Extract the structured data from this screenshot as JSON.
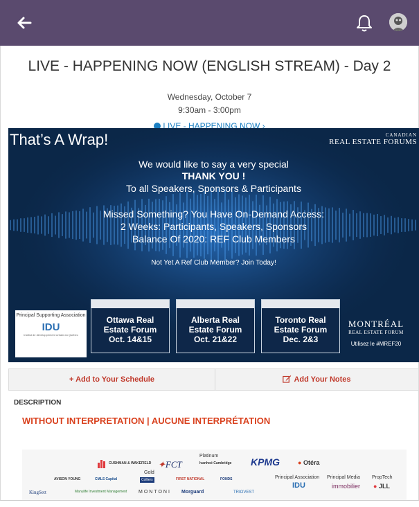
{
  "header": {
    "back_icon": "arrow-left-icon",
    "bell_icon": "bell-icon",
    "avatar_icon": "user-avatar"
  },
  "event": {
    "title": "LIVE - HAPPENING NOW (ENGLISH STREAM) - Day 2",
    "date": "Wednesday, October 7",
    "time": "9:30am - 3:00pm",
    "status_link": "LIVE - HAPPENING NOW ›"
  },
  "banner": {
    "headline": "That’s A Wrap!",
    "logo_line1": "CANADIAN",
    "logo_line2": "REAL ESTATE FORUMS",
    "lines": [
      "We would like to say a very special",
      "THANK YOU !",
      "To all Speakers, Sponsors & Participants",
      "Missed Something? You Have On-Demand Access:",
      "2 Weeks: Participants, Speakers, Sponsors",
      "Balance Of 2020: REF Club Members",
      "Not Yet A Ref Club Member? Join Today!"
    ],
    "sponsor_card": {
      "label": "Principal Supporting Association",
      "logo_text": "IDU",
      "logo_sub": "Institut de développement urbain du Québec"
    },
    "forums": [
      {
        "lines": [
          "Ottawa Real",
          "Estate Forum",
          "Oct. 14&15"
        ]
      },
      {
        "lines": [
          "Alberta Real",
          "Estate Forum",
          "Oct. 21&22"
        ]
      },
      {
        "lines": [
          "Toronto Real",
          "Estate Forum",
          "Dec. 2&3"
        ]
      }
    ],
    "montreal": {
      "line1": "MONTRÉAL",
      "line2": "REAL ESTATE FORUM",
      "hashtag": "Utilisez le #MREF20"
    }
  },
  "actions": {
    "schedule_label": "+ Add to Your Schedule",
    "notes_label": "Add Your Notes"
  },
  "description": {
    "label": "DESCRIPTION",
    "text": "WITHOUT INTERPRETATION | AUCUNE INTERPRÉTATION"
  },
  "sponsors": {
    "platinum_label": "Platinum",
    "gold_label": "Gold",
    "principal_association_label": "Principal Association",
    "principal_media_label": "Principal Media",
    "proptech_label": "PropTech",
    "logos": {
      "cushman": "CUSHMAN & WAKEFIELD",
      "fct": "FCT",
      "ivanhoe": "Ivanhoé Cambridge",
      "kpmg": "KPMG",
      "otera": "Otéra",
      "avison": "AVISON YOUNG",
      "cmls": "CMLS Capital",
      "colliers": "Colliers",
      "first_national": "FIRST NATIONAL",
      "fonds": "FONDS",
      "idu": "IDU",
      "immobilier": "immobilier",
      "jll": "JLL",
      "kingsett": "KingSett",
      "manulife": "Manulife Investment Management",
      "montoni": "MONTONI",
      "morguard": "Morguard",
      "triovest": "TRIOVEST"
    }
  },
  "colors": {
    "topbar": "#5a4a6e",
    "link": "#1b7fc2",
    "action_red": "#c0392b",
    "description_orange": "#d9411e",
    "banner_navy": "#0b2748"
  }
}
